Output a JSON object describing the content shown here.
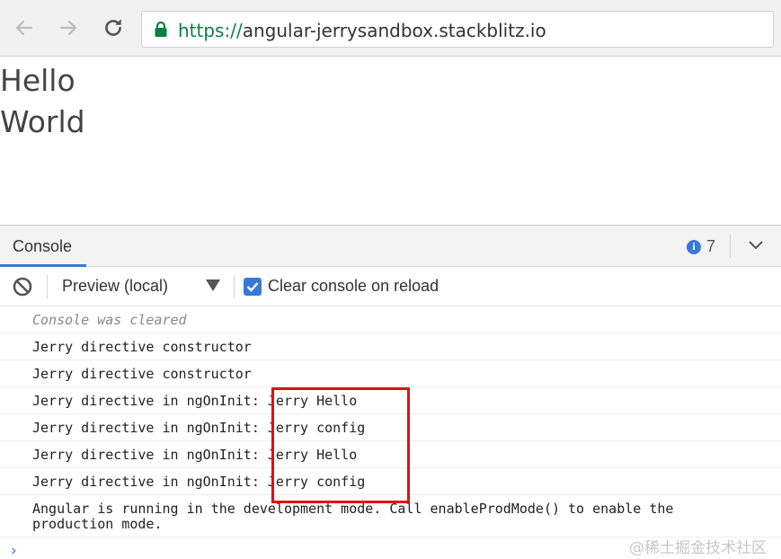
{
  "browser": {
    "url_scheme": "https://",
    "url_host": "angular-jerrysandbox.stackblitz.io"
  },
  "page": {
    "lines": [
      "Hello",
      "World"
    ]
  },
  "devtools": {
    "active_tab": "Console",
    "info_count": "7",
    "context": "Preview (local)",
    "clear_on_reload_label": "Clear console on reload",
    "clear_on_reload_checked": true,
    "messages": [
      "Console was cleared",
      "Jerry directive constructor",
      "Jerry directive constructor",
      "Jerry directive in ngOnInit: Jerry Hello",
      "Jerry directive in ngOnInit: Jerry config",
      "Jerry directive in ngOnInit: Jerry Hello",
      "Jerry directive in ngOnInit: Jerry config",
      "Angular is running in the development mode. Call enableProdMode() to enable the production mode."
    ],
    "prompt": "›"
  },
  "colors": {
    "accent": "#3879d9",
    "highlight": "#e01010",
    "secure": "#0b8043"
  },
  "watermark": "@稀土掘金技术社区"
}
